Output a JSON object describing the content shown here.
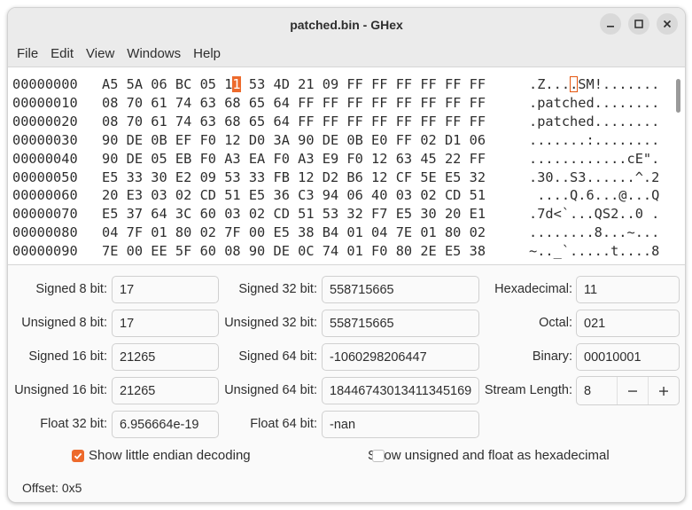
{
  "window": {
    "title": "patched.bin - GHex"
  },
  "menu": [
    "File",
    "Edit",
    "View",
    "Windows",
    "Help"
  ],
  "hex": {
    "rows": [
      {
        "offset": "00000000",
        "bytes": [
          "A5",
          "5A",
          "06",
          "BC",
          "05",
          "11",
          "53",
          "4D",
          "21",
          "09",
          "FF",
          "FF",
          "FF",
          "FF",
          "FF",
          "FF"
        ],
        "ascii": ".Z....SM!......."
      },
      {
        "offset": "00000010",
        "bytes": [
          "08",
          "70",
          "61",
          "74",
          "63",
          "68",
          "65",
          "64",
          "FF",
          "FF",
          "FF",
          "FF",
          "FF",
          "FF",
          "FF",
          "FF"
        ],
        "ascii": ".patched........"
      },
      {
        "offset": "00000020",
        "bytes": [
          "08",
          "70",
          "61",
          "74",
          "63",
          "68",
          "65",
          "64",
          "FF",
          "FF",
          "FF",
          "FF",
          "FF",
          "FF",
          "FF",
          "FF"
        ],
        "ascii": ".patched........"
      },
      {
        "offset": "00000030",
        "bytes": [
          "90",
          "DE",
          "0B",
          "EF",
          "F0",
          "12",
          "D0",
          "3A",
          "90",
          "DE",
          "0B",
          "E0",
          "FF",
          "02",
          "D1",
          "06"
        ],
        "ascii": ".......:........"
      },
      {
        "offset": "00000040",
        "bytes": [
          "90",
          "DE",
          "05",
          "EB",
          "F0",
          "A3",
          "EA",
          "F0",
          "A3",
          "E9",
          "F0",
          "12",
          "63",
          "45",
          "22",
          "FF"
        ],
        "ascii": "............cE\"."
      },
      {
        "offset": "00000050",
        "bytes": [
          "E5",
          "33",
          "30",
          "E2",
          "09",
          "53",
          "33",
          "FB",
          "12",
          "D2",
          "B6",
          "12",
          "CF",
          "5E",
          "E5",
          "32"
        ],
        "ascii": ".30..S3......^.2"
      },
      {
        "offset": "00000060",
        "bytes": [
          "20",
          "E3",
          "03",
          "02",
          "CD",
          "51",
          "E5",
          "36",
          "C3",
          "94",
          "06",
          "40",
          "03",
          "02",
          "CD",
          "51"
        ],
        "ascii": " ....Q.6...@...Q"
      },
      {
        "offset": "00000070",
        "bytes": [
          "E5",
          "37",
          "64",
          "3C",
          "60",
          "03",
          "02",
          "CD",
          "51",
          "53",
          "32",
          "F7",
          "E5",
          "30",
          "20",
          "E1"
        ],
        "ascii": ".7d<`...QS2..0 ."
      },
      {
        "offset": "00000080",
        "bytes": [
          "04",
          "7F",
          "01",
          "80",
          "02",
          "7F",
          "00",
          "E5",
          "38",
          "B4",
          "01",
          "04",
          "7E",
          "01",
          "80",
          "02"
        ],
        "ascii": "........8...~..."
      },
      {
        "offset": "00000090",
        "bytes": [
          "7E",
          "00",
          "EE",
          "5F",
          "60",
          "08",
          "90",
          "DE",
          "0C",
          "74",
          "01",
          "F0",
          "80",
          "2E",
          "E5",
          "38"
        ],
        "ascii": "~.._`.....t....8"
      }
    ]
  },
  "selected_byte_index": 5,
  "inspector": {
    "signed8": {
      "label": "Signed 8 bit:",
      "value": "17"
    },
    "unsigned8": {
      "label": "Unsigned 8 bit:",
      "value": "17"
    },
    "signed16": {
      "label": "Signed 16 bit:",
      "value": "21265"
    },
    "unsigned16": {
      "label": "Unsigned 16 bit:",
      "value": "21265"
    },
    "float32": {
      "label": "Float 32 bit:",
      "value": "6.956664e-19"
    },
    "signed32": {
      "label": "Signed 32 bit:",
      "value": "558715665"
    },
    "unsigned32": {
      "label": "Unsigned 32 bit:",
      "value": "558715665"
    },
    "signed64": {
      "label": "Signed 64 bit:",
      "value": "-1060298206447"
    },
    "unsigned64": {
      "label": "Unsigned 64 bit:",
      "value": "18446743013411345169"
    },
    "float64": {
      "label": "Float 64 bit:",
      "value": "-nan"
    },
    "hexadecimal": {
      "label": "Hexadecimal:",
      "value": "11"
    },
    "octal": {
      "label": "Octal:",
      "value": "021"
    },
    "binary": {
      "label": "Binary:",
      "value": "00010001"
    },
    "stream_length": {
      "label": "Stream Length:",
      "value": "8"
    }
  },
  "options": {
    "little_endian": {
      "label": "Show little endian decoding",
      "checked": true
    },
    "unsigned_hex": {
      "label": "Show unsigned and float as hexadecimal",
      "checked": false
    }
  },
  "status": {
    "offset": "Offset: 0x5"
  },
  "colors": {
    "accent": "#ed6a2c",
    "titlebar": "#ebebeb"
  },
  "icons": {
    "minimize": "minimize-icon",
    "maximize": "maximize-icon",
    "close": "close-icon",
    "minus": "minus-icon",
    "plus": "plus-icon",
    "check": "checkmark-icon"
  }
}
